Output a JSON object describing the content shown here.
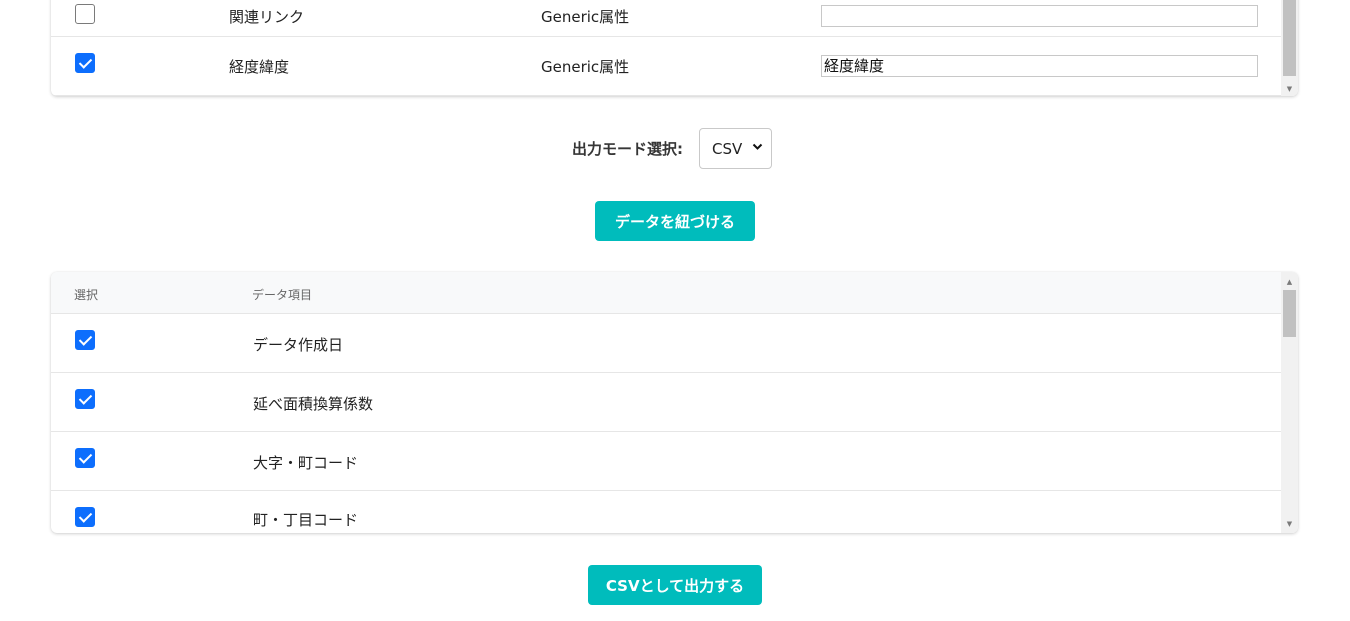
{
  "top_table": {
    "rows": [
      {
        "checked": false,
        "item": "関連リンク",
        "type": "Generic属性",
        "value": ""
      },
      {
        "checked": true,
        "item": "経度緯度",
        "type": "Generic属性",
        "value": "経度緯度"
      }
    ]
  },
  "mode": {
    "label": "出力モード選択:",
    "selected": "CSV"
  },
  "link_button_label": "データを紐づける",
  "bottom_table": {
    "headers": {
      "select": "選択",
      "item": "データ項目"
    },
    "rows": [
      {
        "checked": true,
        "item": "データ作成日"
      },
      {
        "checked": true,
        "item": "延べ面積換算係数"
      },
      {
        "checked": true,
        "item": "大字・町コード"
      },
      {
        "checked": true,
        "item": "町・丁目コード"
      }
    ]
  },
  "csv_button_label": "CSVとして出力する",
  "colors": {
    "accent": "#00bcbc",
    "checkbox": "#0d6efd"
  }
}
